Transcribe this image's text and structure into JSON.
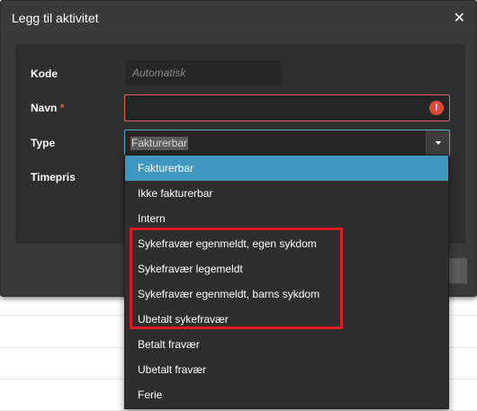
{
  "modal": {
    "title": "Legg til aktivitet",
    "close_icon": "close-icon"
  },
  "form": {
    "code_label": "Kode",
    "code_placeholder": "Automatisk",
    "name_label": "Navn",
    "name_required": "*",
    "name_value": "",
    "name_error_icon": "!",
    "type_label": "Type",
    "type_value": "Fakturerbar",
    "hourly_rate_label": "Timepris"
  },
  "dropdown": {
    "options": [
      "Fakturerbar",
      "Ikke fakturerbar",
      "Intern",
      "Sykefravær egenmeldt, egen sykdom",
      "Sykefravær legemeldt",
      "Sykefravær egenmeldt, barns sykdom",
      "Ubetalt sykefravær",
      "Betalt fravær",
      "Ubetalt fravær",
      "Ferie"
    ],
    "selected": "Fakturerbar"
  },
  "colors": {
    "selected_option": "#3f97bd",
    "annotation_box": "#e01a22",
    "error": "#e2473b",
    "focus_border": "#58a9cf"
  }
}
